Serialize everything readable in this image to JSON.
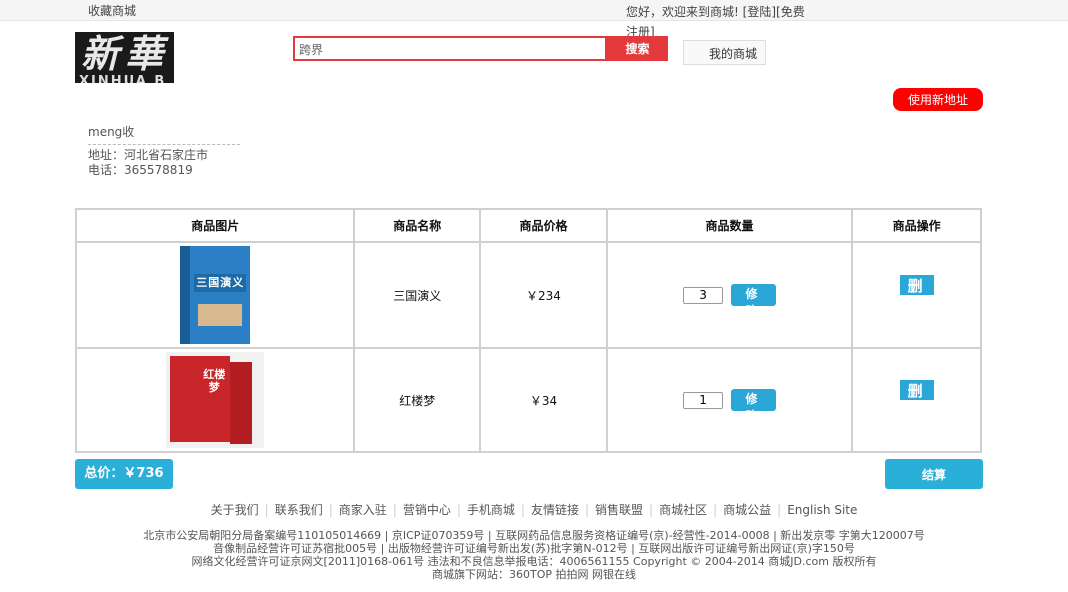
{
  "topbar": {
    "favorite": "收藏商城",
    "welcome": "您好，欢迎来到商城!",
    "login": "[登陆]",
    "register": "[免费注册]"
  },
  "header": {
    "logo_text": "新華",
    "logo_sub": "XINHUA B",
    "search_value": "跨界",
    "search_button": "搜索",
    "my_mall": "我的商城"
  },
  "address": {
    "new_address_button": "使用新地址",
    "receiver": "meng收",
    "address_line": "地址：河北省石家庄市",
    "phone_line": "电话：365578819"
  },
  "cart": {
    "columns": [
      "商品图片",
      "商品名称",
      "商品价格",
      "商品数量",
      "商品操作"
    ],
    "items": [
      {
        "name": "三国演义",
        "price": "￥234",
        "qty": "3",
        "cover_title": "三国演义"
      },
      {
        "name": "红楼梦",
        "price": "￥34",
        "qty": "1",
        "cover_title": "红楼梦"
      }
    ],
    "modify_label": "修 改",
    "delete_label": "删 除"
  },
  "summary": {
    "total": "总价：￥736",
    "checkout": "结算"
  },
  "footer": {
    "links": [
      "关于我们",
      "联系我们",
      "商家入驻",
      "营销中心",
      "手机商城",
      "友情链接",
      "销售联盟",
      "商城社区",
      "商城公益",
      "English Site"
    ],
    "lines": [
      "北京市公安局朝阳分局备案编号110105014669 | 京ICP证070359号 | 互联网药品信息服务资格证编号(京)-经营性-2014-0008 | 新出发京零 字第大120007号",
      "音像制品经营许可证苏宿批005号 | 出版物经营许可证编号新出发(苏)批字第N-012号 | 互联网出版许可证编号新出网证(京)字150号",
      "网络文化经营许可证京网文[2011]0168-061号 违法和不良信息举报电话：4006561155 Copyright © 2004-2014 商城JD.com 版权所有",
      "商城旗下网站：360TOP 拍拍网 网银在线"
    ]
  },
  "colors": {
    "accent_red": "#e4393c",
    "accent_blue": "#2aa7d6"
  }
}
